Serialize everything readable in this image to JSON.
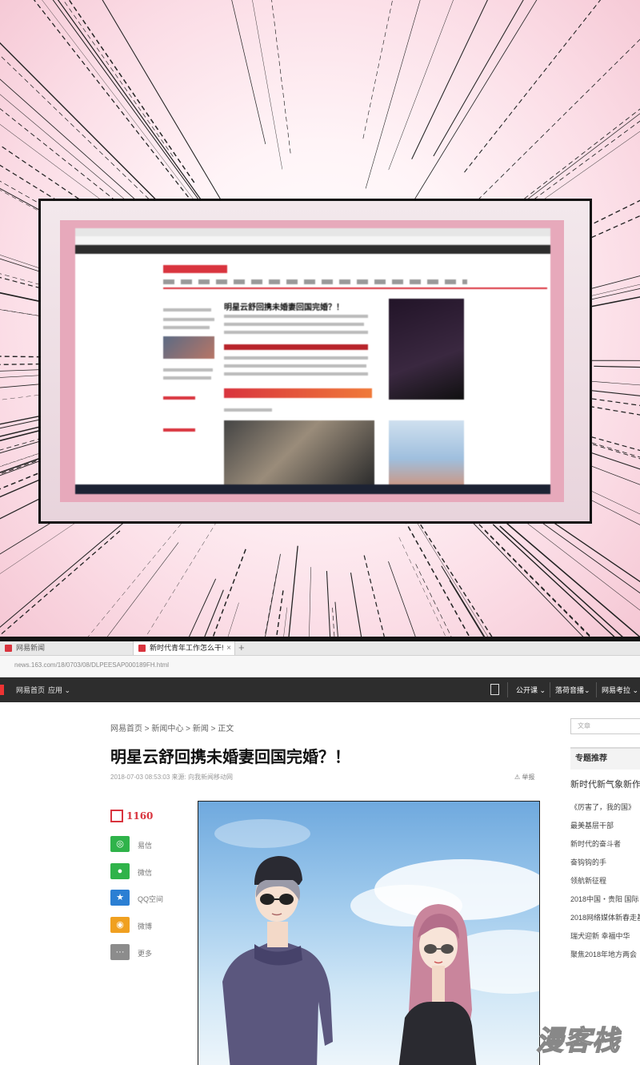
{
  "top_panel": {
    "screen_headline": "明星云舒回携未婚妻回国完婚？！"
  },
  "browser": {
    "tabs": [
      {
        "label": "网易新闻"
      },
      {
        "label": "新时代青年工作怎么干!",
        "close": "×"
      }
    ],
    "new_tab": "+",
    "url": "news.163.com/18/0703/08/DLPEESAP000189FH.html",
    "nav_left": [
      "网易首页",
      "应用 ⌄"
    ],
    "nav_right": [
      "公开课 ⌄",
      "落荷音播⌄",
      "网易考拉 ⌄"
    ],
    "breadcrumb": "网易首页 > 新闻中心 > 新闻 > 正文",
    "article_title": "明星云舒回携未婚妻回国完婚？！",
    "meta": "2018-07-03 08:53:03   来源: 向我新闻移动网",
    "report": "⚠ 举报",
    "comment_count": "1160",
    "share": [
      {
        "label": "易信",
        "color": "#2fb34a",
        "icon": "yixin-icon"
      },
      {
        "label": "微信",
        "color": "#2fb34a",
        "icon": "wechat-icon"
      },
      {
        "label": "QQ空间",
        "color": "#2b7fd3",
        "icon": "qzone-icon"
      },
      {
        "label": "微博",
        "color": "#f0a020",
        "icon": "weibo-icon"
      },
      {
        "label": "更多",
        "color": "#8c8c8c",
        "icon": "more-icon"
      }
    ],
    "search_placeholder": "文章",
    "topic_heading": "专题推荐",
    "topic_main": "新时代新气象新作",
    "topics": [
      "《厉害了，我的国》",
      "最美基层干部",
      "新时代的奋斗者",
      "奋钩钩的手",
      "领航新征程",
      "2018中国・贵阳 国际",
      "2018网络媒体新春走基",
      "瑞犬迎新 幸福中华",
      "聚焦2018年地方两会"
    ]
  },
  "watermark": "漫客栈"
}
